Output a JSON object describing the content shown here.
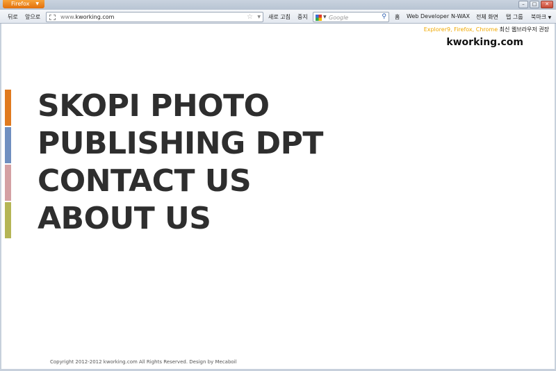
{
  "browser": {
    "app_button_label": "Firefox",
    "nav": {
      "back_label": "뒤로",
      "forward_label": "앞으로",
      "reload_label": "새로 고침",
      "stop_label": "중지"
    },
    "url": {
      "prefix": "www.",
      "domain": "kworking.com"
    },
    "search": {
      "placeholder": "Google"
    },
    "toolbar": {
      "home_label": "홈",
      "web_developer_label": "Web Developer",
      "nwax_label": "N-WAX",
      "fullscreen_label": "전체 화면",
      "tab_group_label": "탭 그룹",
      "bookmarks_label": "북마크"
    }
  },
  "page": {
    "notice": {
      "browsers": "Explorer9, Firefox, Chrome",
      "recommendation": "최신 웹브라우저 권장"
    },
    "logo": "kworking.com",
    "menu": [
      {
        "label": "SKOPI PHOTO",
        "color": "#e07a1f"
      },
      {
        "label": "PUBLISHING DPT",
        "color": "#6f8fc0"
      },
      {
        "label": "CONTACT US",
        "color": "#d4a0a3"
      },
      {
        "label": "ABOUT US",
        "color": "#b5b555"
      }
    ],
    "footer": "Copyright 2012-2012 kworking.com All Rights Reserved. Design by Mecaboil"
  }
}
